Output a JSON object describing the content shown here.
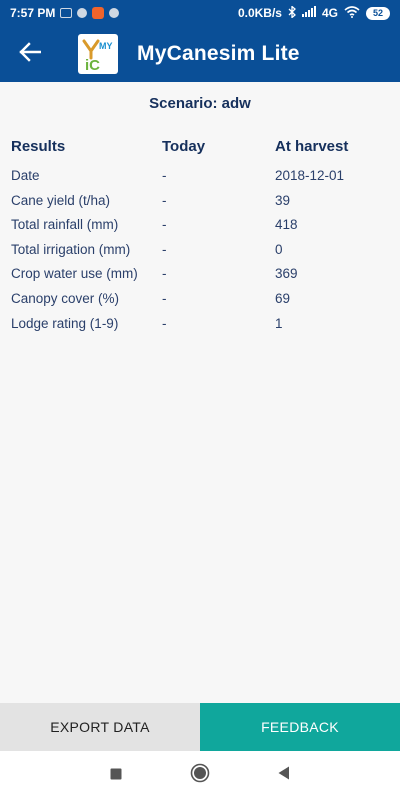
{
  "status_bar": {
    "time": "7:57 PM",
    "network_speed": "0.0KB/s",
    "network_type": "4G",
    "battery": "52"
  },
  "app_bar": {
    "title": "MyCanesim Lite",
    "back_icon": "arrow-left-icon",
    "logo_text_top": "MY",
    "logo_text_bottom": "iC"
  },
  "main": {
    "scenario_label": "Scenario: adw",
    "columns": [
      "Results",
      "Today",
      "At harvest"
    ],
    "rows": [
      [
        "Date",
        "-",
        "2018-12-01"
      ],
      [
        "Cane yield (t/ha)",
        "-",
        "39"
      ],
      [
        "Total rainfall (mm)",
        "-",
        "418"
      ],
      [
        "Total irrigation (mm)",
        "-",
        "0"
      ],
      [
        "Crop water use (mm)",
        "-",
        "369"
      ],
      [
        "Canopy cover (%)",
        "-",
        "69"
      ],
      [
        "Lodge rating (1-9)",
        "-",
        "1"
      ]
    ]
  },
  "actions": {
    "export_label": "EXPORT DATA",
    "feedback_label": "FEEDBACK"
  },
  "nav": {
    "recents_icon": "square-icon",
    "home_icon": "circle-icon",
    "back_icon": "triangle-back-icon"
  },
  "colors": {
    "primary": "#0a4f97",
    "accent": "#10a79c",
    "text_dark": "#16305c",
    "export_bg": "#e3e3e3"
  }
}
